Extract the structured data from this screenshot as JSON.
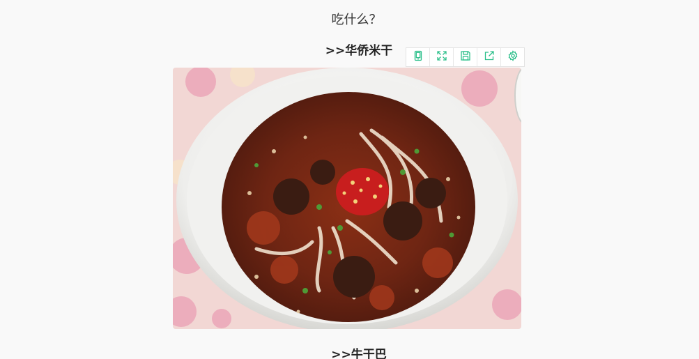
{
  "article": {
    "question": "吃什么？",
    "sections": [
      {
        "heading": ">>华侨米干"
      },
      {
        "heading": ">>牛干巴"
      }
    ]
  },
  "toolbar": {
    "accent_color": "#2bbf8a",
    "buttons": [
      {
        "icon": "mobile-preview-icon"
      },
      {
        "icon": "fullscreen-icon"
      },
      {
        "icon": "save-icon"
      },
      {
        "icon": "share-icon"
      },
      {
        "icon": "settings-icon"
      }
    ]
  },
  "image": {
    "subject": "bowl of rice noodles in chili broth",
    "colors": {
      "tablecloth": "#f2d7d4",
      "bowl": "#f4f4f2",
      "broth": "#7a2a16",
      "chili": "#c81e1e"
    }
  }
}
